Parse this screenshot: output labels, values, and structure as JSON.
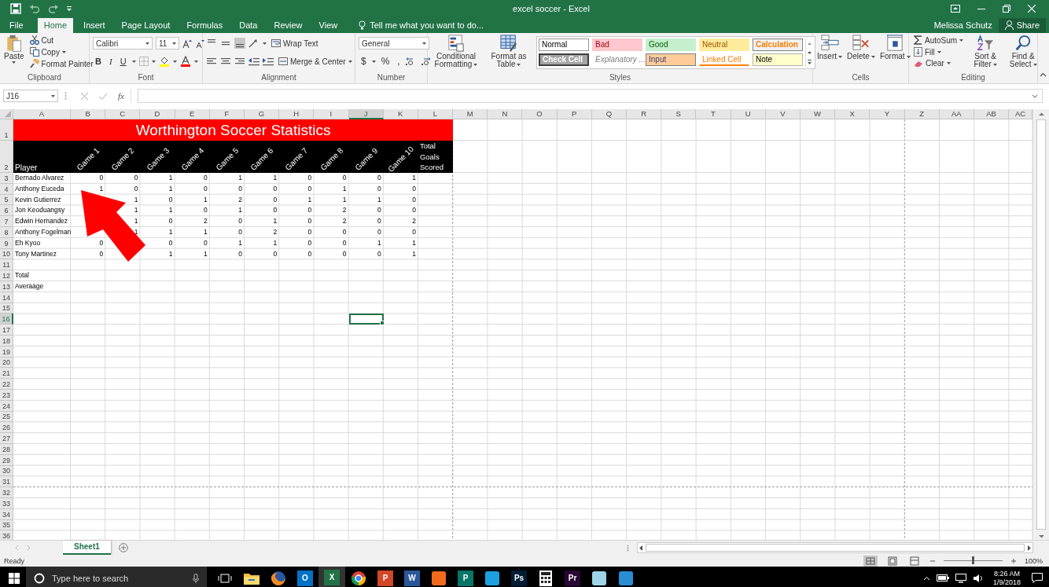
{
  "window": {
    "title": "excel soccer - Excel",
    "user": "Melissa Schutz",
    "share": "Share"
  },
  "tabs": [
    {
      "label": "File",
      "selected": false
    },
    {
      "label": "Home",
      "selected": true
    },
    {
      "label": "Insert",
      "selected": false
    },
    {
      "label": "Page Layout",
      "selected": false
    },
    {
      "label": "Formulas",
      "selected": false
    },
    {
      "label": "Data",
      "selected": false
    },
    {
      "label": "Review",
      "selected": false
    },
    {
      "label": "View",
      "selected": false
    }
  ],
  "tell_me": {
    "placeholder": "Tell me what you want to do..."
  },
  "ribbon": [
    {
      "kind": "clipboard",
      "label": "Clipboard",
      "paste": "Paste",
      "items": [
        "Cut",
        "Copy",
        "Format Painter"
      ]
    },
    {
      "kind": "font",
      "label": "Font",
      "font": "Calibri",
      "size": "11",
      "styles": [
        "B",
        "I",
        "U"
      ]
    },
    {
      "kind": "alignment",
      "label": "Alignment",
      "wrap": "Wrap Text",
      "merge": "Merge & Center"
    },
    {
      "kind": "number",
      "label": "Number",
      "format": "General",
      "symbols": [
        "$",
        "%",
        ","
      ]
    },
    {
      "kind": "styles",
      "label": "Styles",
      "commands": [
        "Conditional Formatting",
        "Format as Table"
      ],
      "gallery": [
        {
          "label": "Normal",
          "kind": "normal"
        },
        {
          "label": "Bad",
          "kind": "bad"
        },
        {
          "label": "Good",
          "kind": "good"
        },
        {
          "label": "Neutral",
          "kind": "neutral"
        },
        {
          "label": "Calculation",
          "kind": "calculation"
        },
        {
          "label": "Check Cell",
          "kind": "check"
        },
        {
          "label": "Explanatory ...",
          "kind": "explanatory"
        },
        {
          "label": "Input",
          "kind": "input"
        },
        {
          "label": "Linked Cell",
          "kind": "linked"
        },
        {
          "label": "Note",
          "kind": "note"
        }
      ]
    },
    {
      "kind": "cells",
      "label": "Cells",
      "commands": [
        "Insert",
        "Delete",
        "Format"
      ]
    },
    {
      "kind": "editing",
      "label": "Editing",
      "items": [
        "AutoSum",
        "Fill",
        "Clear"
      ],
      "commands": [
        "Sort & Filter",
        "Find & Select"
      ]
    }
  ],
  "formula_bar": {
    "name_box": "J16",
    "fx": "fx"
  },
  "sheet": {
    "columns": [
      {
        "label": "A",
        "selected": false
      },
      {
        "label": "B",
        "selected": false
      },
      {
        "label": "C",
        "selected": false
      },
      {
        "label": "D",
        "selected": false
      },
      {
        "label": "E",
        "selected": false
      },
      {
        "label": "F",
        "selected": false
      },
      {
        "label": "G",
        "selected": false
      },
      {
        "label": "H",
        "selected": false
      },
      {
        "label": "I",
        "selected": false
      },
      {
        "label": "J",
        "selected": true
      },
      {
        "label": "K",
        "selected": false
      },
      {
        "label": "L",
        "selected": false
      },
      {
        "label": "M",
        "selected": false
      },
      {
        "label": "N",
        "selected": false
      },
      {
        "label": "O",
        "selected": false
      },
      {
        "label": "P",
        "selected": false
      },
      {
        "label": "Q",
        "selected": false
      },
      {
        "label": "R",
        "selected": false
      },
      {
        "label": "S",
        "selected": false
      },
      {
        "label": "T",
        "selected": false
      },
      {
        "label": "U",
        "selected": false
      },
      {
        "label": "V",
        "selected": false
      },
      {
        "label": "W",
        "selected": false
      },
      {
        "label": "X",
        "selected": false
      },
      {
        "label": "Y",
        "selected": false
      },
      {
        "label": "Z",
        "selected": false
      },
      {
        "label": "AA",
        "selected": false
      },
      {
        "label": "AB",
        "selected": false
      },
      {
        "label": "AC",
        "selected": false
      }
    ],
    "rows": [
      {
        "label": "1",
        "selected": false
      },
      {
        "label": "2",
        "selected": false
      },
      {
        "label": "3",
        "selected": false
      },
      {
        "label": "4",
        "selected": false
      },
      {
        "label": "5",
        "selected": false
      },
      {
        "label": "6",
        "selected": false
      },
      {
        "label": "7",
        "selected": false
      },
      {
        "label": "8",
        "selected": false
      },
      {
        "label": "9",
        "selected": false
      },
      {
        "label": "10",
        "selected": false
      },
      {
        "label": "11",
        "selected": false
      },
      {
        "label": "12",
        "selected": false
      },
      {
        "label": "13",
        "selected": false
      },
      {
        "label": "14",
        "selected": false
      },
      {
        "label": "15",
        "selected": false
      },
      {
        "label": "16",
        "selected": true
      },
      {
        "label": "17",
        "selected": false
      },
      {
        "label": "18",
        "selected": false
      },
      {
        "label": "19",
        "selected": false
      },
      {
        "label": "20",
        "selected": false
      },
      {
        "label": "21",
        "selected": false
      },
      {
        "label": "22",
        "selected": false
      },
      {
        "label": "23",
        "selected": false
      },
      {
        "label": "24",
        "selected": false
      },
      {
        "label": "25",
        "selected": false
      },
      {
        "label": "26",
        "selected": false
      },
      {
        "label": "27",
        "selected": false
      },
      {
        "label": "28",
        "selected": false
      },
      {
        "label": "29",
        "selected": false
      },
      {
        "label": "30",
        "selected": false
      },
      {
        "label": "31",
        "selected": false
      },
      {
        "label": "32",
        "selected": false
      },
      {
        "label": "33",
        "selected": false
      },
      {
        "label": "34",
        "selected": false
      },
      {
        "label": "35",
        "selected": false
      },
      {
        "label": "36",
        "selected": false
      }
    ],
    "title": "Worthington Soccer Statistics",
    "headers": [
      "Player",
      "Game 1",
      "Game 2",
      "Game 3",
      "Game 4",
      "Game 5",
      "Game 6",
      "Game 7",
      "Game 8",
      "Game 9",
      "Game 10",
      "Total Goals Scored"
    ],
    "players": [
      {
        "name": "Bernado Alvarez",
        "game_1": "0",
        "game_2": "0",
        "game_3": "1",
        "game_4": "0",
        "game_5": "1",
        "game_6": "1",
        "game_7": "0",
        "game_8": "0",
        "game_9": "0",
        "game_10": "1"
      },
      {
        "name": "Anthony Euceda",
        "game_1": "1",
        "game_2": "0",
        "game_3": "1",
        "game_4": "0",
        "game_5": "0",
        "game_6": "0",
        "game_7": "0",
        "game_8": "1",
        "game_9": "0",
        "game_10": "0"
      },
      {
        "name": "Kevin Gutierrez",
        "game_2": "1",
        "game_3": "0",
        "game_4": "1",
        "game_5": "2",
        "game_6": "0",
        "game_7": "1",
        "game_8": "1",
        "game_9": "1",
        "game_10": "0"
      },
      {
        "name": "Jon Keoduangsy",
        "game_2": "1",
        "game_3": "1",
        "game_4": "0",
        "game_5": "1",
        "game_6": "0",
        "game_7": "0",
        "game_8": "2",
        "game_9": "0",
        "game_10": "0"
      },
      {
        "name": "Edwin Hernandez",
        "game_2": "1",
        "game_3": "0",
        "game_4": "2",
        "game_5": "0",
        "game_6": "1",
        "game_7": "0",
        "game_8": "2",
        "game_9": "0",
        "game_10": "2"
      },
      {
        "name": "Anthony Fogelman",
        "game_2": "1",
        "game_3": "1",
        "game_4": "1",
        "game_5": "0",
        "game_6": "2",
        "game_7": "0",
        "game_8": "0",
        "game_9": "0",
        "game_10": "0"
      },
      {
        "name": "Eh Kyoo",
        "game_1": "0",
        "game_3": "0",
        "game_4": "0",
        "game_5": "1",
        "game_6": "1",
        "game_7": "0",
        "game_8": "0",
        "game_9": "1",
        "game_10": "1"
      },
      {
        "name": "Tony Martinez",
        "game_1": "0",
        "game_3": "1",
        "game_4": "1",
        "game_5": "0",
        "game_6": "0",
        "game_7": "0",
        "game_8": "0",
        "game_9": "0",
        "game_10": "1"
      }
    ],
    "summary": [
      "Total",
      "Averaage"
    ]
  },
  "annotations": [
    {
      "kind": "arrow"
    }
  ],
  "sheet_tabs": [
    {
      "label": "Sheet1",
      "selected": true
    }
  ],
  "status_bar": {
    "text": "Ready",
    "zoom": "100%",
    "zoom_slider": {
      "level": 0.5
    }
  },
  "taskbar": {
    "search": {
      "placeholder": "Type here to search"
    },
    "apps": [
      {
        "kind": "folder",
        "selected": false
      },
      {
        "kind": "firefox",
        "selected": false
      },
      {
        "kind": "tile",
        "glyph": "O",
        "color": "#0072c6",
        "selected": false
      },
      {
        "kind": "tile",
        "glyph": "X",
        "color": "#217346",
        "selected": true
      },
      {
        "kind": "chrome",
        "selected": false
      },
      {
        "kind": "tile",
        "glyph": "P",
        "color": "#d24726",
        "selected": false
      },
      {
        "kind": "tile",
        "glyph": "W",
        "color": "#2b579a",
        "selected": false
      },
      {
        "kind": "plain",
        "color": "#f26b1d",
        "selected": false
      },
      {
        "kind": "tile",
        "glyph": "P",
        "color": "#077568",
        "selected": false
      },
      {
        "kind": "plain",
        "color": "#1ba1e2",
        "selected": false
      },
      {
        "kind": "tile",
        "glyph": "Ps",
        "color": "#001d34",
        "selected": false
      },
      {
        "kind": "calc",
        "selected": false
      },
      {
        "kind": "tile",
        "glyph": "Pr",
        "color": "#2a0634",
        "selected": false
      },
      {
        "kind": "plain",
        "color": "#9fd4e8",
        "selected": false
      },
      {
        "kind": "plain",
        "color": "#2a8dd4",
        "selected": false
      }
    ],
    "time": "8:26 AM",
    "date": "1/9/2018"
  }
}
